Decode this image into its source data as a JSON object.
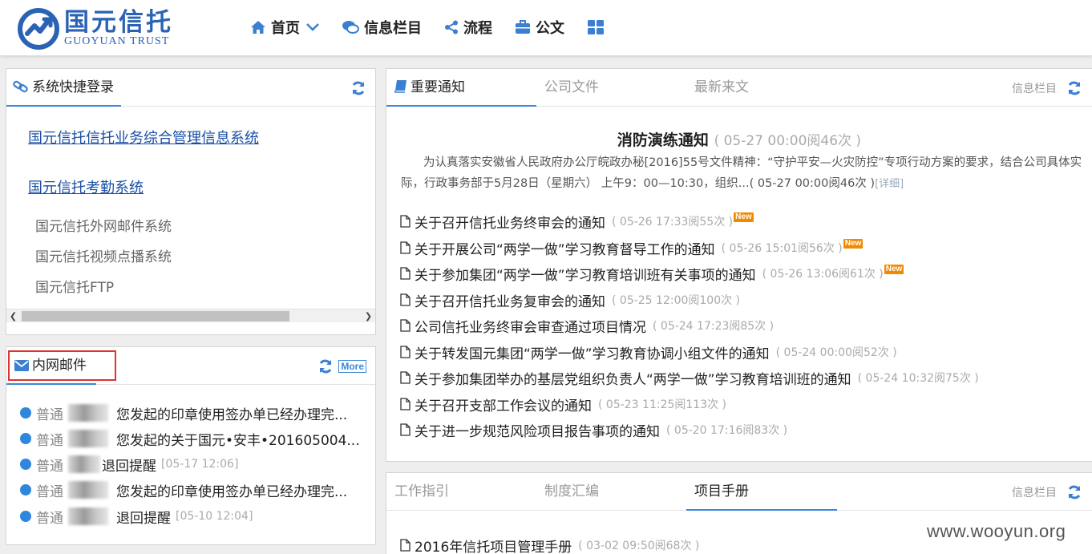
{
  "header": {
    "logo_cn": "国元信托",
    "logo_en": "GUOYUAN TRUST",
    "nav": [
      {
        "label": "首页",
        "icon": "home-icon"
      },
      {
        "label": "信息栏目",
        "icon": "chat-icon"
      },
      {
        "label": "流程",
        "icon": "share-icon"
      },
      {
        "label": "公文",
        "icon": "briefcase-icon"
      }
    ]
  },
  "quick_login": {
    "title": "系统快捷登录",
    "systems": [
      "国元信托信托业务综合管理信息系统",
      "国元信托考勤系统",
      "国元信托外网邮件系统",
      "国元信托视频点播系统",
      "国元信托FTP"
    ]
  },
  "mail": {
    "title": "内网邮件",
    "more": "More",
    "items": [
      {
        "type": "普通",
        "title": "您发起的印章使用签办单已经办理完...",
        "time": ""
      },
      {
        "type": "普通",
        "title": "您发起的关于国元•安丰•201605004...",
        "time": ""
      },
      {
        "type": "普通",
        "title": "退回提醒",
        "time": "[05-17 12:06]"
      },
      {
        "type": "普通",
        "title": "您发起的印章使用签办单已经办理完...",
        "time": ""
      },
      {
        "type": "普通",
        "title": "退回提醒",
        "time": "[05-10 12:04]"
      }
    ]
  },
  "notices": {
    "tabs": [
      "重要通知",
      "公司文件",
      "最新来文"
    ],
    "column_link": "信息栏目",
    "feature": {
      "title": "消防演练通知",
      "meta": "( 05-27 00:00阅46次 )",
      "line1": "为认真落实安徽省人民政府办公厅皖政办秘[2016]55号文件精神：“守护平安—火灾防控”专项行动方案的要求，结合公司具体实",
      "line2": "际，行政事务部于5月28日（星期六） 上午9：00—10:30，组织...( 05-27 00:00阅46次 )",
      "detail": "[详细]"
    },
    "new_label": "New",
    "items": [
      {
        "title": "关于召开信托业务终审会的通知",
        "meta": "( 05-26 17:33阅55次 )"
      },
      {
        "title": "关于开展公司“两学一做”学习教育督导工作的通知",
        "meta": "( 05-26 15:01阅56次 )"
      },
      {
        "title": "关于参加集团“两学一做”学习教育培训班有关事项的通知",
        "meta": "( 05-26 13:06阅61次 )"
      },
      {
        "title": "关于召开信托业务复审会的通知",
        "meta": "( 05-25 12:00阅100次 )"
      },
      {
        "title": "公司信托业务终审会审查通过项目情况",
        "meta": "( 05-24 17:23阅85次 )"
      },
      {
        "title": "关于转发国元集团“两学一做”学习教育协调小组文件的通知",
        "meta": "( 05-24 00:00阅52次 )"
      },
      {
        "title": "关于参加集团举办的基层党组织负责人“两学一做”学习教育培训班的通知",
        "meta": "( 05-24 10:32阅75次 )"
      },
      {
        "title": "关于召开支部工作会议的通知",
        "meta": "( 05-23 11:25阅113次 )"
      },
      {
        "title": "关于进一步规范风险项目报告事项的通知",
        "meta": "( 05-20 17:16阅83次 )"
      }
    ]
  },
  "guides": {
    "tabs": [
      "工作指引",
      "制度汇编",
      "项目手册"
    ],
    "column_link": "信息栏目",
    "items": [
      {
        "title": "2016年信托项目管理手册",
        "meta": "( 03-02 09:50阅68次 )"
      }
    ]
  },
  "watermark": "www.wooyun.org",
  "colors": {
    "brand": "#2a63b5",
    "accent": "#3a88d8",
    "new_badge": "#f08a00",
    "highlight_box": "#e23030"
  }
}
